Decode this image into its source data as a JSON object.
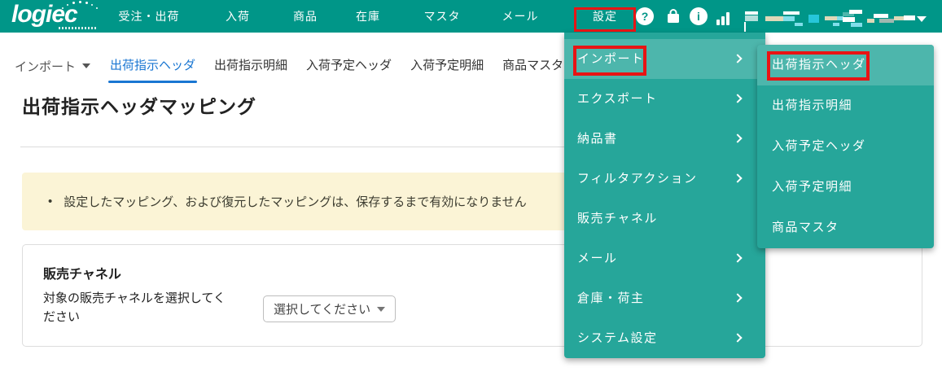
{
  "brand": {
    "logo_text": "logiec"
  },
  "header": {
    "nav": [
      {
        "label": "受注・出荷"
      },
      {
        "label": "入荷"
      },
      {
        "label": "商品"
      },
      {
        "label": "在庫"
      },
      {
        "label": "マスタ"
      },
      {
        "label": "メール"
      },
      {
        "label": "設定",
        "annotated": true
      }
    ],
    "icons": {
      "help_glyph": "?",
      "info_glyph": "i"
    }
  },
  "tabs": {
    "dropdown_label": "インポート",
    "items": [
      {
        "label": "出荷指示ヘッダ",
        "active": true
      },
      {
        "label": "出荷指示明細"
      },
      {
        "label": "入荷予定ヘッダ"
      },
      {
        "label": "入荷予定明細"
      },
      {
        "label": "商品マスタ"
      }
    ]
  },
  "page": {
    "title": "出荷指示ヘッダマッピング"
  },
  "notice": {
    "bullet": "•",
    "text": "設定したマッピング、および復元したマッピングは、保存するまで有効になりません"
  },
  "panel": {
    "heading": "販売チャネル",
    "label": "対象の販売チャネルを選択してください",
    "select_value": "選択してください"
  },
  "menu": {
    "items": [
      {
        "label": "インポート",
        "hovered": true,
        "annotated": true
      },
      {
        "label": "エクスポート"
      },
      {
        "label": "納品書"
      },
      {
        "label": "フィルタアクション"
      },
      {
        "label": "販売チャネル"
      },
      {
        "label": "メール"
      },
      {
        "label": "倉庫・荷主"
      },
      {
        "label": "システム設定"
      }
    ]
  },
  "submenu": {
    "items": [
      {
        "label": "出荷指示ヘッダ",
        "hovered": true,
        "annotated": true
      },
      {
        "label": "出荷指示明細"
      },
      {
        "label": "入荷予定ヘッダ"
      },
      {
        "label": "入荷予定明細"
      },
      {
        "label": "商品マスタ"
      }
    ]
  },
  "colors": {
    "header_teal": "#009688",
    "menu_teal": "#26a69a",
    "menu_hover_teal": "#4db6ac",
    "active_tab_blue": "#1976d2",
    "notice_bg": "#fbf4d6",
    "annotation_red": "#e81414"
  }
}
